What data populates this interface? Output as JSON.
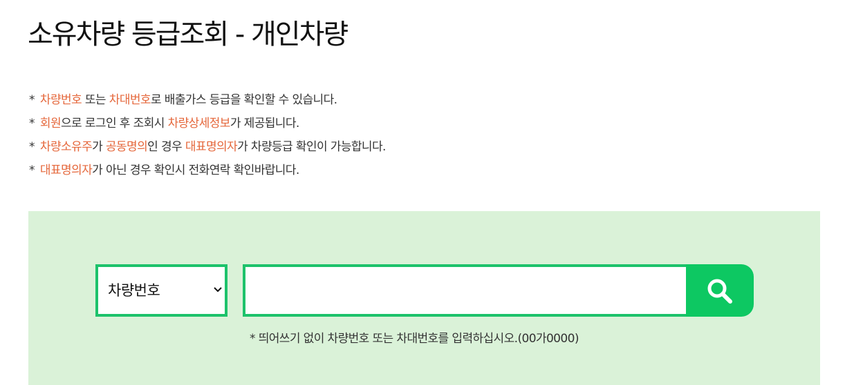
{
  "title": "소유차량 등급조회 - 개인차량",
  "notices": [
    {
      "star": "*",
      "hl1": "차량번호",
      "t1": " 또는 ",
      "hl2": "차대번호",
      "t2": "로 배출가스 등급을 확인할 수 있습니다."
    },
    {
      "star": "*",
      "hl1": "회원",
      "t1": "으로 로그인 후 조회시 ",
      "hl2": "차량상세정보",
      "t2": "가 제공됩니다."
    },
    {
      "star": "*",
      "hl1": "차량소유주",
      "t1": "가 ",
      "hl2": "공동명의",
      "t2": "인 경우 ",
      "hl3": "대표명의자",
      "t3": "가 차량등급 확인이 가능합니다."
    },
    {
      "star": "*",
      "hl1": "대표명의자",
      "t1": "가 아닌 경우 확인시 전화연락 확인바랍니다."
    }
  ],
  "search": {
    "select_value": "차량번호",
    "input_value": "",
    "button_icon": "search-icon",
    "hint": "* 띄어쓰기 없이 차량번호 또는 차대번호를 입력하십시오.(00가0000)"
  },
  "colors": {
    "highlight": "#e5673b",
    "panel_bg": "#daf2d8",
    "accent_border": "#1dc26b",
    "button_bg": "#0dc862"
  }
}
